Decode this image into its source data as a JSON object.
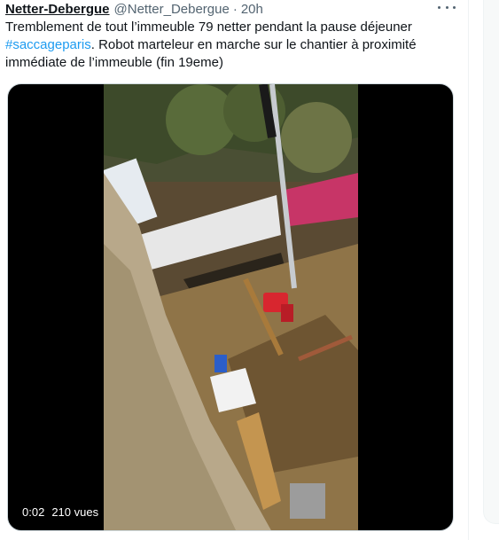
{
  "tweet": {
    "display_name": "Netter-Debergue",
    "handle": "@Netter_Debergue",
    "separator": "·",
    "time": "20h",
    "more_icon": "ellipsis-icon",
    "text_part1": "Tremblement de tout l’immeuble 79 netter pendant la pause déjeuner",
    "hashtag": "#saccageparis",
    "text_part2": ". Robot marteleur en marche sur le chantier à proximité immédiate de l’immeuble (fin 19eme)"
  },
  "video": {
    "current_time": "0:02",
    "views": "210 vues"
  },
  "colors": {
    "link": "#1d9bf0",
    "text": "#0f1419",
    "secondary": "#536471"
  }
}
